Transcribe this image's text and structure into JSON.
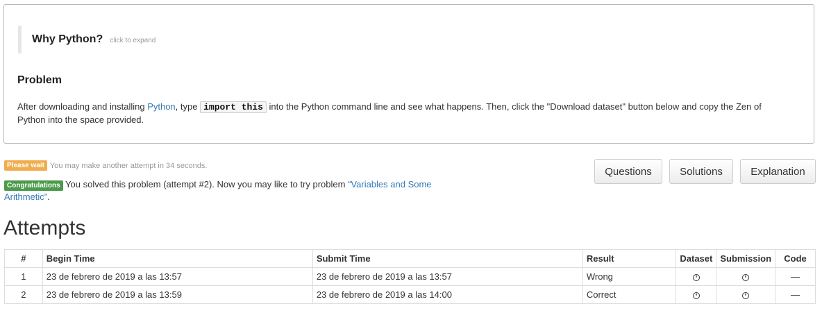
{
  "why_python": {
    "title": "Why Python?",
    "hint": "click to expand"
  },
  "problem": {
    "heading": "Problem",
    "text_before_link": "After downloading and installing ",
    "python_link": "Python",
    "text_after_link": ", type ",
    "code": "import this",
    "text_after_code": " into the Python command line and see what happens. Then, click the \"Download dataset\" button below and copy the Zen of Python into the space provided."
  },
  "status": {
    "wait_label": "Please wait",
    "wait_text": "You may make another attempt in 34 seconds.",
    "congrats_label": "Congratulations",
    "congrats_text": " You solved this problem (attempt #2). Now you may like to try problem ",
    "next_problem_link": "“Variables and Some Arithmetic”",
    "congrats_end": "."
  },
  "buttons": {
    "questions": "Questions",
    "solutions": "Solutions",
    "explanation": "Explanation"
  },
  "attempts": {
    "heading": "Attempts",
    "columns": [
      "#",
      "Begin Time",
      "Submit Time",
      "Result",
      "Dataset",
      "Submission",
      "Code"
    ],
    "rows": [
      {
        "num": "1",
        "begin": "23 de febrero de 2019 a las 13:57",
        "submit": "23 de febrero de 2019 a las 13:57",
        "result": "Wrong",
        "code": "—"
      },
      {
        "num": "2",
        "begin": "23 de febrero de 2019 a las 13:59",
        "submit": "23 de febrero de 2019 a las 14:00",
        "result": "Correct",
        "code": "—"
      }
    ]
  },
  "colors": {
    "link": "#337ab7",
    "warning": "#f0ad4e",
    "success": "#4c9a4c"
  }
}
